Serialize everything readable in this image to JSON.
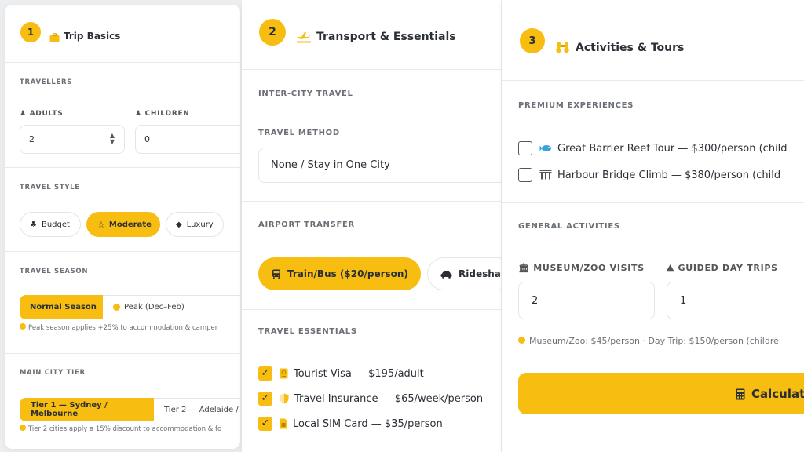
{
  "colors": {
    "accent": "#f7bd11",
    "text": "#2b2f36",
    "muted": "#6b6f76",
    "border": "#e3e5e8"
  },
  "trip_basics": {
    "step": "1",
    "title": "Trip Basics",
    "travellers_label": "TRAVELLERS",
    "adults_label": "ADULTS",
    "adults_value": "2",
    "children_label": "CHILDREN",
    "children_value": "0",
    "travel_style_label": "TRAVEL STYLE",
    "styles": [
      {
        "label": "Budget",
        "icon": "sprout-icon",
        "selected": false
      },
      {
        "label": "Moderate",
        "icon": "star-icon",
        "selected": true
      },
      {
        "label": "Luxury",
        "icon": "diamond-icon",
        "selected": false
      }
    ],
    "season_label": "TRAVEL SEASON",
    "season_options": [
      "Normal Season",
      "Peak (Dec–Feb)"
    ],
    "season_selected": "Normal Season",
    "season_note": "Peak season applies +25% to accommodation & camper",
    "tier_label": "MAIN CITY TIER",
    "tier_options": [
      "Tier 1 — Sydney / Melbourne",
      "Tier 2 — Adelaide /"
    ],
    "tier_selected": "Tier 1 — Sydney / Melbourne",
    "tier_note": "Tier 2 cities apply a 15% discount to accommodation & fo"
  },
  "transport": {
    "step": "2",
    "title": "Transport & Essentials",
    "intercity_label": "INTER-CITY TRAVEL",
    "method_label": "TRAVEL METHOD",
    "method_value": "None / Stay in One City",
    "airport_label": "AIRPORT TRANSFER",
    "airport_options": [
      {
        "label": "Train/Bus ($20/person)",
        "icon": "bus-icon",
        "selected": true
      },
      {
        "label": "Rideshar",
        "icon": "car-icon",
        "selected": false
      }
    ],
    "essentials_label": "TRAVEL ESSENTIALS",
    "essentials": [
      {
        "label": "Tourist Visa — $195/adult",
        "icon": "passport-icon",
        "checked": true
      },
      {
        "label": "Travel Insurance — $65/week/person",
        "icon": "shield-icon",
        "checked": true
      },
      {
        "label": "Local SIM Card — $35/person",
        "icon": "sim-card-icon",
        "checked": true
      }
    ]
  },
  "activities": {
    "step": "3",
    "title": "Activities & Tours",
    "premium_label": "PREMIUM EXPERIENCES",
    "premium": [
      {
        "label": "Great Barrier Reef Tour — $300/person (child",
        "icon": "fish-icon",
        "checked": false
      },
      {
        "label": "Harbour Bridge Climb — $380/person (child",
        "icon": "bridge-icon",
        "checked": false
      }
    ],
    "general_label": "GENERAL ACTIVITIES",
    "museum_label": "MUSEUM/ZOO VISITS",
    "museum_value": "2",
    "guided_label": "GUIDED DAY TRIPS",
    "guided_value": "1",
    "pricing_note": "Museum/Zoo: $45/person · Day Trip: $150/person (childre",
    "calculate_label": "Calculat"
  }
}
